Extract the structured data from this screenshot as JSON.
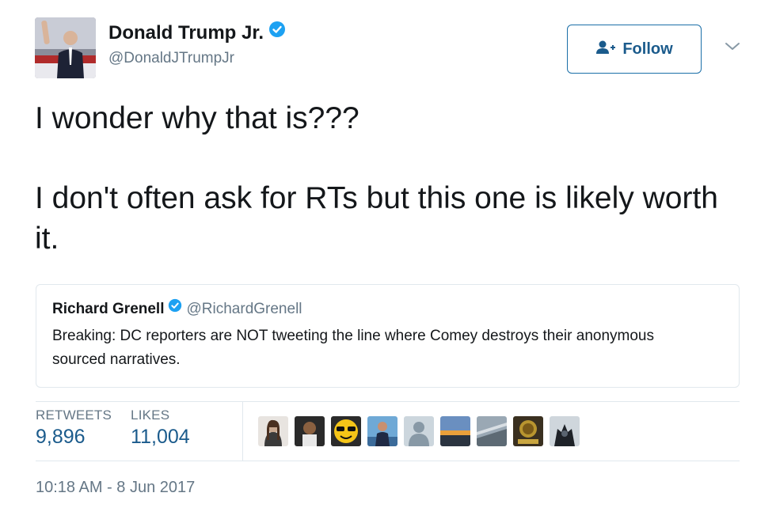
{
  "author": {
    "name": "Donald Trump Jr.",
    "handle": "@DonaldJTrumpJr",
    "verified": true,
    "avatar_icon": "profile-photo"
  },
  "follow_button": {
    "label": "Follow",
    "icon": "add-user-icon"
  },
  "menu_icon": "chevron-down-icon",
  "tweet": {
    "line1": "I wonder why that is???",
    "line2": "I don't often ask for RTs but this one is likely worth it."
  },
  "quoted_tweet": {
    "name": "Richard Grenell",
    "handle": "@RichardGrenell",
    "verified": true,
    "text": "Breaking: DC reporters are NOT tweeting the line where Comey destroys their anonymous sourced narratives."
  },
  "stats": {
    "retweets_label": "RETWEETS",
    "retweets_value": "9,896",
    "likes_label": "LIKES",
    "likes_value": "11,004"
  },
  "likers": [
    "liker-avatar",
    "liker-avatar",
    "liker-avatar",
    "liker-avatar",
    "default-avatar",
    "liker-avatar",
    "liker-avatar",
    "liker-avatar",
    "liker-avatar"
  ],
  "timestamp": "10:18 AM - 8 Jun 2017",
  "colors": {
    "link": "#1b5b8c",
    "verified": "#1da1f2",
    "muted": "#657786",
    "border": "#e1e8ed"
  }
}
